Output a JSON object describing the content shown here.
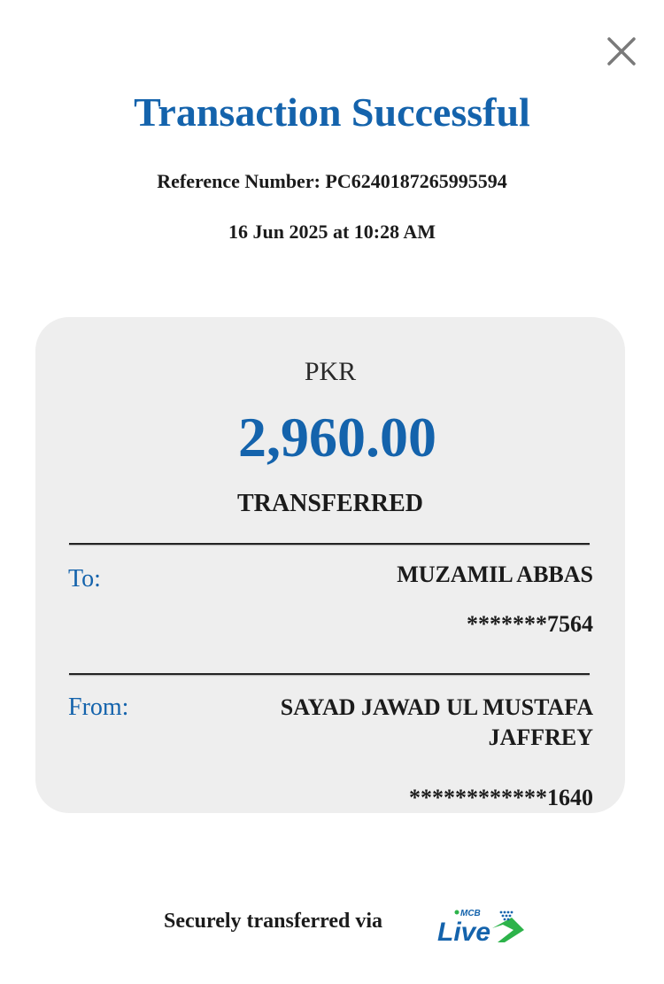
{
  "header": {
    "title": "Transaction Successful",
    "reference": "Reference Number: PC6240187265995594",
    "datetime": "16 Jun 2025 at 10:28 AM"
  },
  "card": {
    "currency": "PKR",
    "amount": "2,960.00",
    "status": "TRANSFERRED",
    "to": {
      "label": "To:",
      "name": "MUZAMIL ABBAS",
      "account": "*******7564"
    },
    "from": {
      "label": "From:",
      "name_line1": "SAYAD JAWAD UL MUSTAFA",
      "name_line2": "JAFFREY",
      "account": "************1640"
    }
  },
  "footer": {
    "text": "Securely transferred via",
    "logo_brand": "MCB",
    "logo_word": "Live"
  },
  "colors": {
    "accent": "#1463ac",
    "logo_green": "#2db34a",
    "card_bg": "#eeeeee"
  },
  "icons": {
    "close": "close-icon"
  }
}
